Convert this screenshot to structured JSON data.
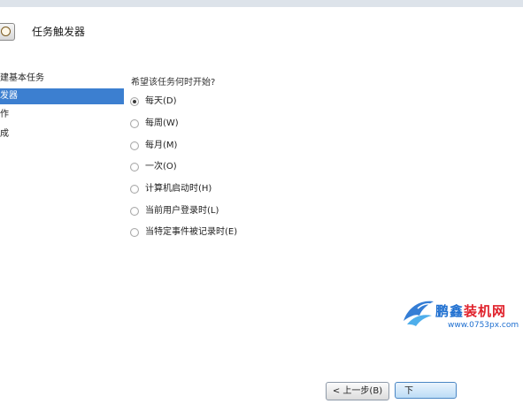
{
  "window": {
    "title": "任务触发器"
  },
  "sidebar": {
    "items": [
      {
        "label": "建基本任务"
      },
      {
        "label": "发器"
      },
      {
        "label": "作"
      },
      {
        "label": "成"
      }
    ]
  },
  "main": {
    "question": "希望该任务何时开始?",
    "options": [
      {
        "label": "每天(D)",
        "checked": true
      },
      {
        "label": "每周(W)",
        "checked": false
      },
      {
        "label": "每月(M)",
        "checked": false
      },
      {
        "label": "一次(O)",
        "checked": false
      },
      {
        "label": "计算机启动时(H)",
        "checked": false
      },
      {
        "label": "当前用户登录时(L)",
        "checked": false
      },
      {
        "label": "当特定事件被记录时(E)",
        "checked": false
      }
    ]
  },
  "footer": {
    "back_label": "< 上一步(B)",
    "next_label": "下"
  },
  "watermark": {
    "brand_part1": "鹏鑫",
    "brand_part2": "装机网",
    "url": "www.0753px.com"
  },
  "colors": {
    "selection": "#3c7fd0",
    "watermark_blue": "#1e6fd0",
    "watermark_red": "#e0212b"
  },
  "icons": {
    "app": "task-scheduler-clock-icon",
    "watermark": "bird-logo-icon"
  }
}
